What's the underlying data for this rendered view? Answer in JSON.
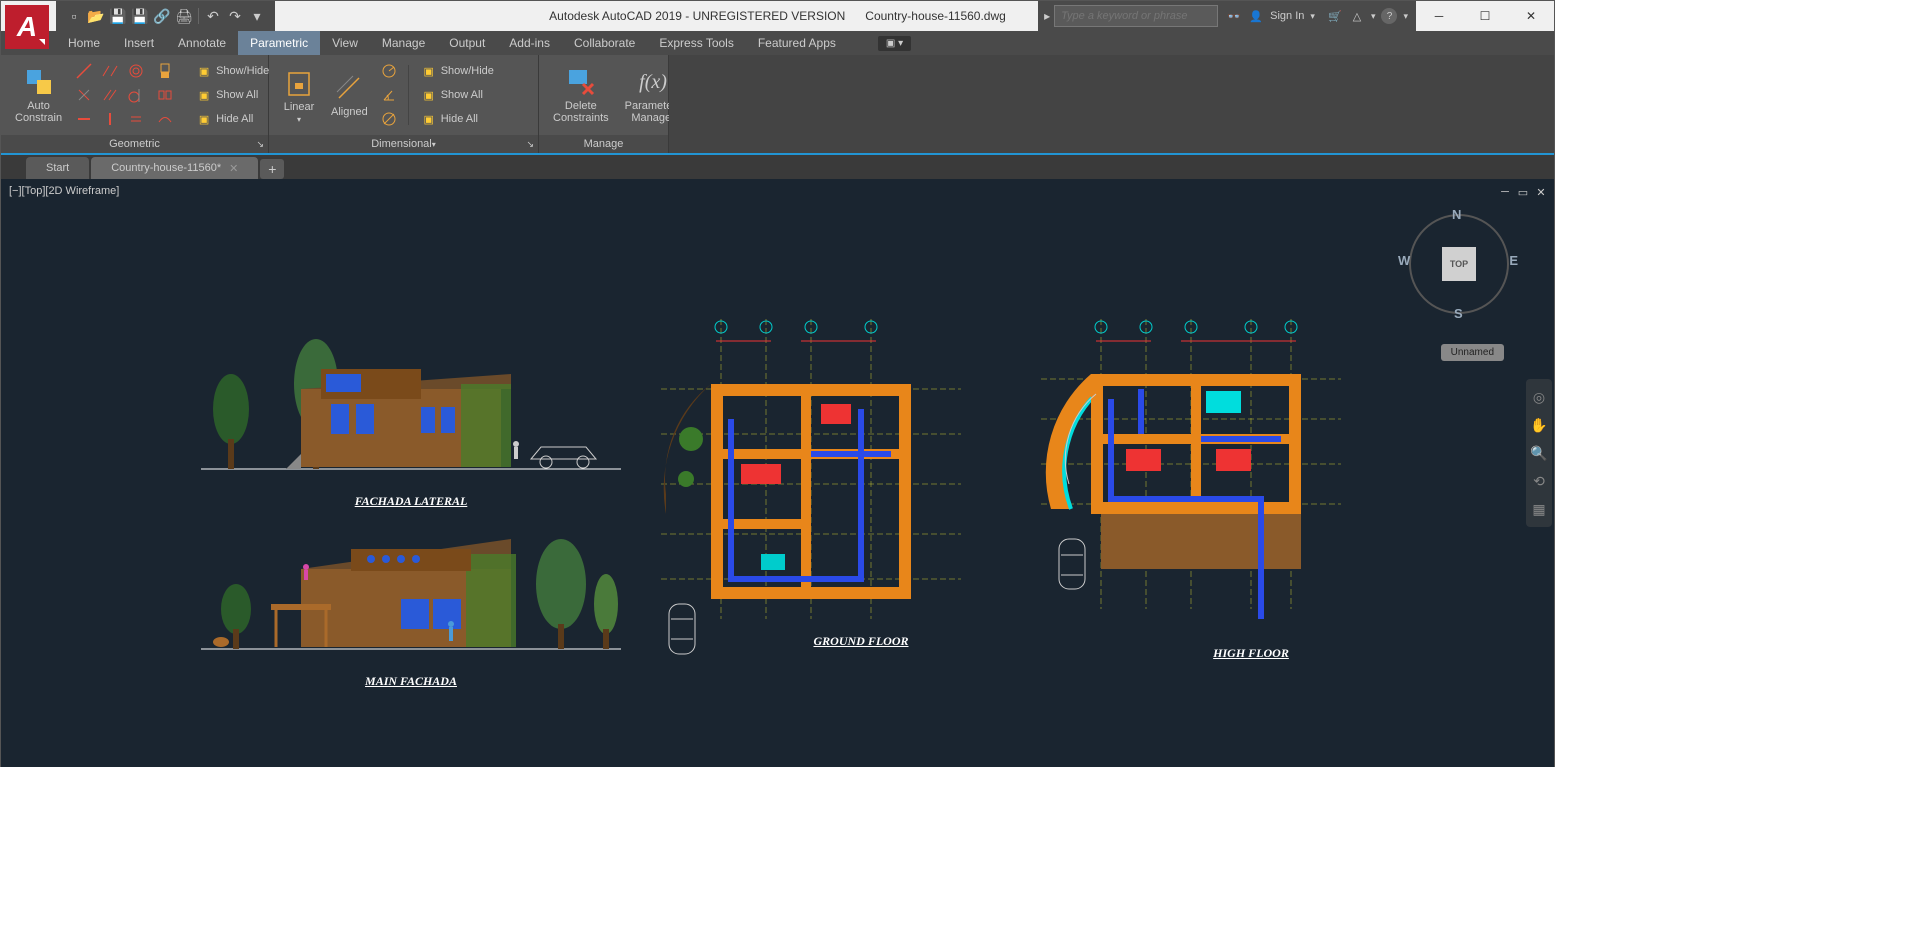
{
  "titlebar": {
    "app_title": "Autodesk AutoCAD 2019 - UNREGISTERED VERSION",
    "doc_name": "Country-house-11560.dwg",
    "search_placeholder": "Type a keyword or phrase",
    "sign_in": "Sign In"
  },
  "menu": {
    "items": [
      "Home",
      "Insert",
      "Annotate",
      "Parametric",
      "View",
      "Manage",
      "Output",
      "Add-ins",
      "Collaborate",
      "Express Tools",
      "Featured Apps"
    ],
    "active_index": 3
  },
  "ribbon": {
    "panels": [
      {
        "label": "Geometric",
        "buttons": {
          "auto": "Auto\nConstrain",
          "show_hide": "Show/Hide",
          "show_all": "Show All",
          "hide_all": "Hide All"
        }
      },
      {
        "label": "Dimensional",
        "buttons": {
          "linear": "Linear",
          "aligned": "Aligned",
          "show_hide": "Show/Hide",
          "show_all": "Show All",
          "hide_all": "Hide All"
        }
      },
      {
        "label": "Manage",
        "buttons": {
          "delete": "Delete\nConstraints",
          "params": "Parameters\nManager"
        }
      }
    ]
  },
  "tabs": {
    "start": "Start",
    "doc": "Country-house-11560*"
  },
  "viewport": {
    "label": "[−][Top][2D Wireframe]",
    "cube_face": "TOP",
    "dirs": {
      "n": "N",
      "s": "S",
      "e": "E",
      "w": "W"
    },
    "badge": "Unnamed"
  },
  "drawings": {
    "elev1_label": "FACHADA LATERAL",
    "elev2_label": "MAIN FACHADA",
    "plan1_label": "GROUND FLOOR",
    "plan2_label": "HIGH FLOOR"
  }
}
